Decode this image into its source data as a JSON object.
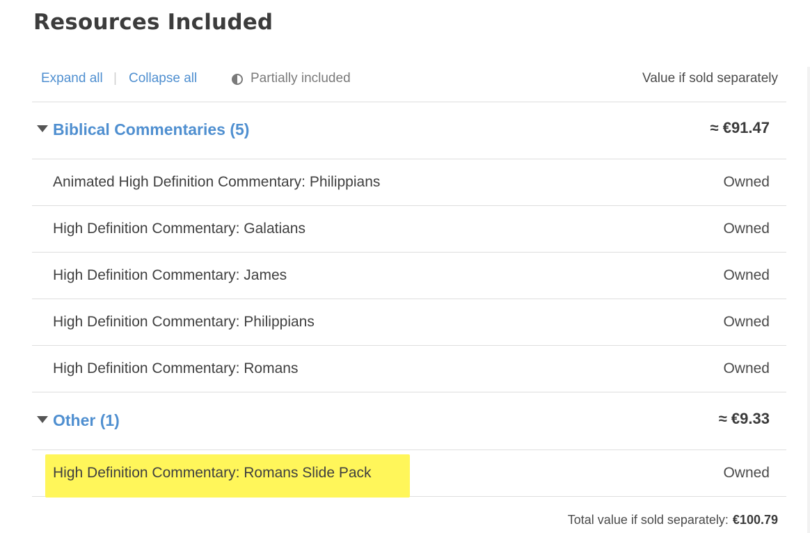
{
  "page": {
    "title": "Resources Included"
  },
  "toolbar": {
    "expand_all": "Expand all",
    "separator": "|",
    "collapse_all": "Collapse all",
    "partially_included": "Partially included",
    "partial_icon": "half-filled-circle-icon",
    "value_header": "Value if sold separately"
  },
  "groups": [
    {
      "title": "Biblical Commentaries (5)",
      "price": "≈ €91.47",
      "items": [
        {
          "name": "Animated High Definition Commentary: Philippians",
          "status": "Owned"
        },
        {
          "name": "High Definition Commentary: Galatians",
          "status": "Owned"
        },
        {
          "name": "High Definition Commentary: James",
          "status": "Owned"
        },
        {
          "name": "High Definition Commentary: Philippians",
          "status": "Owned"
        },
        {
          "name": "High Definition Commentary: Romans",
          "status": "Owned"
        }
      ]
    },
    {
      "title": "Other (1)",
      "price": "≈ €9.33",
      "items": [
        {
          "name": "High Definition Commentary: Romans Slide Pack",
          "status": "Owned",
          "highlighted": true
        }
      ]
    }
  ],
  "total": {
    "label": "Total value if sold separately:",
    "amount": "€100.79"
  },
  "colors": {
    "link": "#4f8fd0",
    "highlight": "#fff65a",
    "divider": "#dedede"
  }
}
